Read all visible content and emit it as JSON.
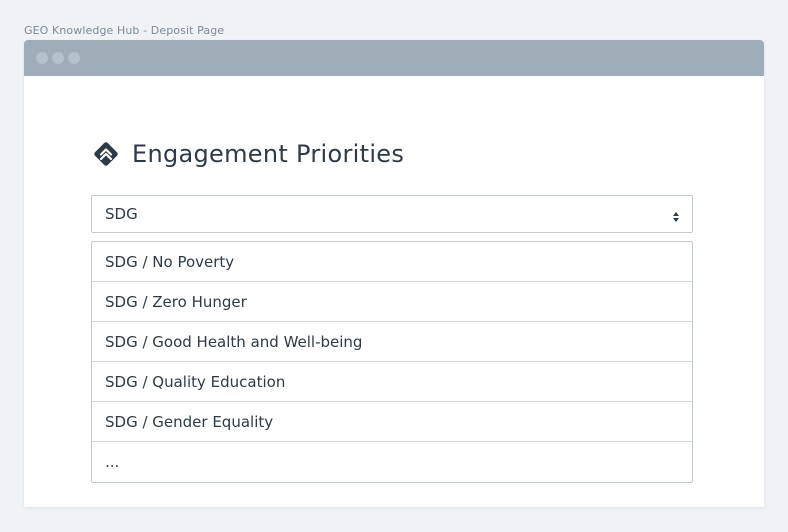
{
  "page_caption": "GEO Knowledge Hub - Deposit Page",
  "window": {
    "titlebar_color": "#9fadb8"
  },
  "section": {
    "icon": "diamond-chevrons-up-icon",
    "title": "Engagement Priorities"
  },
  "select": {
    "value": "SDG",
    "icon": "sort-arrows-icon"
  },
  "options": [
    "SDG / No Poverty",
    "SDG / Zero Hunger",
    "SDG / Good Health and Well-being",
    "SDG / Quality Education",
    "SDG / Gender Equality",
    "..."
  ],
  "colors": {
    "heading_text": "#2d3b48",
    "border": "#c3ccd3",
    "background": "#f0f3f5"
  }
}
